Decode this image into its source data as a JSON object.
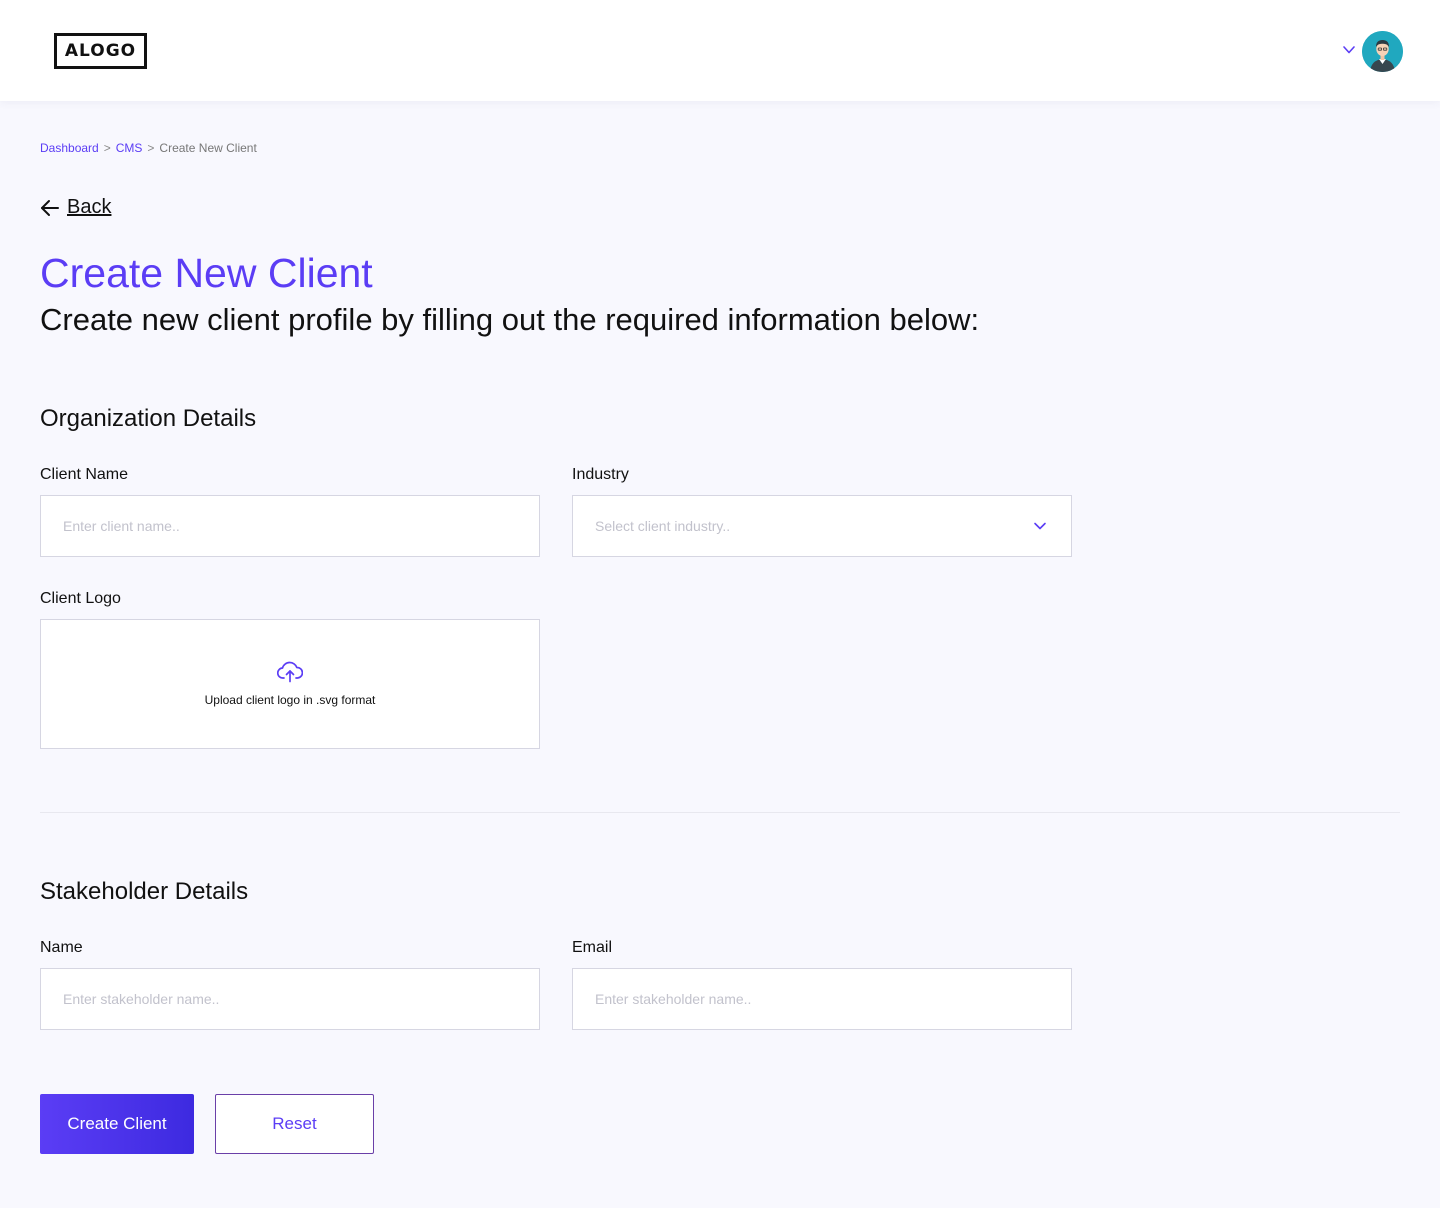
{
  "header": {
    "logo_text": "ALOGO",
    "user_menu_icon": "chevron-down-icon",
    "avatar_icon": "user-avatar"
  },
  "breadcrumb": {
    "items": [
      "Dashboard",
      "CMS"
    ],
    "separator": ">",
    "current": "Create New Client"
  },
  "back": {
    "label": "Back",
    "icon": "arrow-left-icon"
  },
  "page": {
    "title": "Create New Client",
    "subtitle": "Create new client profile by filling out the required information below:"
  },
  "organization": {
    "section_title": "Organization Details",
    "client_name": {
      "label": "Client Name",
      "placeholder": "Enter client name..",
      "value": ""
    },
    "industry": {
      "label": "Industry",
      "placeholder": "Select client industry..",
      "icon": "chevron-down-icon"
    },
    "client_logo": {
      "label": "Client Logo",
      "upload_text": "Upload client logo in .svg format",
      "icon": "cloud-upload-icon"
    }
  },
  "stakeholder": {
    "section_title": "Stakeholder Details",
    "name": {
      "label": "Name",
      "placeholder": "Enter stakeholder name..",
      "value": ""
    },
    "email": {
      "label": "Email",
      "placeholder": "Enter stakeholder name..",
      "value": ""
    }
  },
  "actions": {
    "create_label": "Create Client",
    "reset_label": "Reset"
  },
  "colors": {
    "accent": "#5b3df5",
    "background": "#f8f8fe",
    "border": "#d6d6e2",
    "reset_border": "#6a3fa8"
  }
}
